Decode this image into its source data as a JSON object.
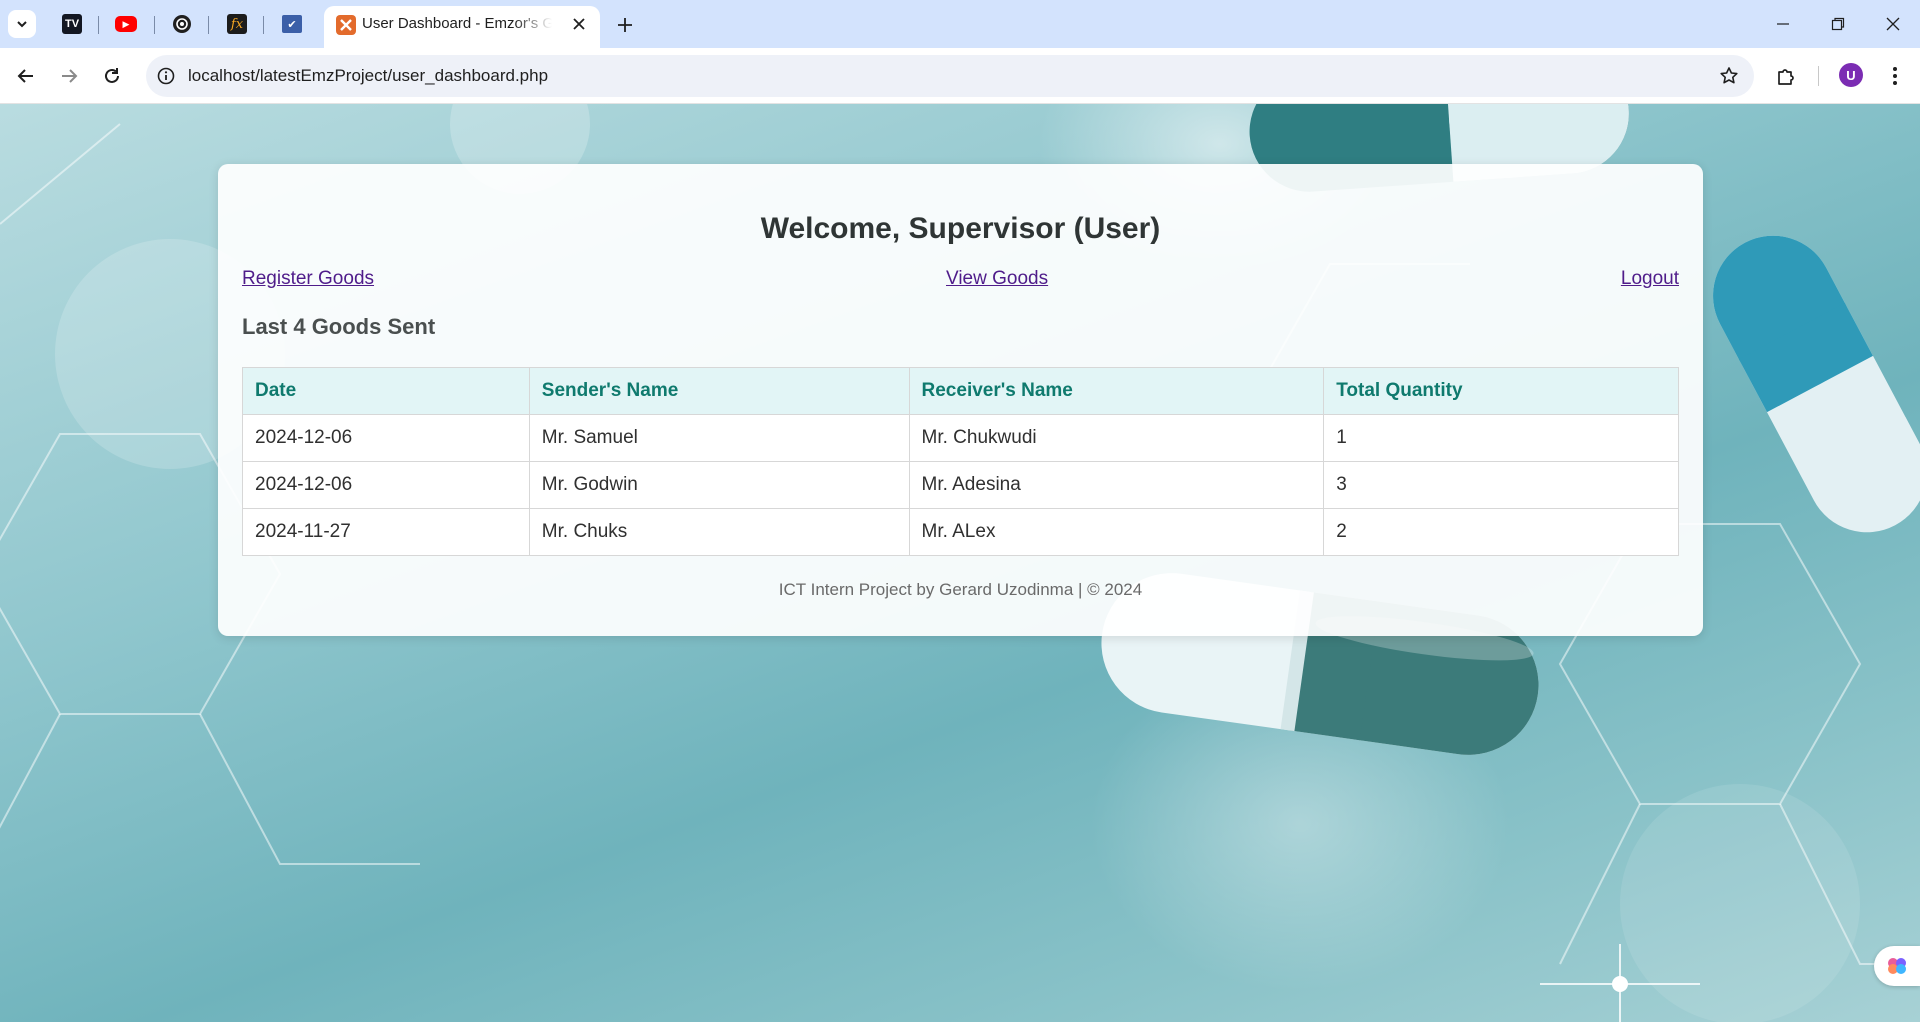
{
  "browser": {
    "pinned_tabs": [
      {
        "name": "tradingview-tab",
        "icon": "tradingview-icon",
        "glyph": "TV"
      },
      {
        "name": "youtube-tab",
        "icon": "youtube-icon",
        "glyph": "▶"
      },
      {
        "name": "chatgpt-tab",
        "icon": "openai-icon",
        "glyph": "◎"
      },
      {
        "name": "fx-tab",
        "icon": "fx-icon",
        "glyph": "fx"
      },
      {
        "name": "site-tab",
        "icon": "site-icon",
        "glyph": "✔"
      }
    ],
    "active_tab_title": "User Dashboard - Emzor's Goods",
    "url": "localhost/latestEmzProject/user_dashboard.php",
    "profile_initial": "U"
  },
  "page": {
    "welcome": "Welcome, Supervisor (User)",
    "links": {
      "register": "Register Goods",
      "view": "View Goods",
      "logout": "Logout"
    },
    "section_title": "Last 4 Goods Sent",
    "table": {
      "headers": [
        "Date",
        "Sender's Name",
        "Receiver's Name",
        "Total Quantity"
      ],
      "rows": [
        [
          "2024-12-06",
          "Mr. Samuel",
          "Mr. Chukwudi",
          "1"
        ],
        [
          "2024-12-06",
          "Mr. Godwin",
          "Mr. Adesina",
          "3"
        ],
        [
          "2024-11-27",
          "Mr. Chuks",
          "Mr. ALex",
          "2"
        ]
      ]
    },
    "footer": "ICT Intern Project by Gerard Uzodinma | © 2024"
  },
  "colors": {
    "header_text": "#0f7a6e",
    "header_bg": "#e2f5f6",
    "link": "#4f1c8a",
    "tabbar": "#d3e3fd"
  }
}
